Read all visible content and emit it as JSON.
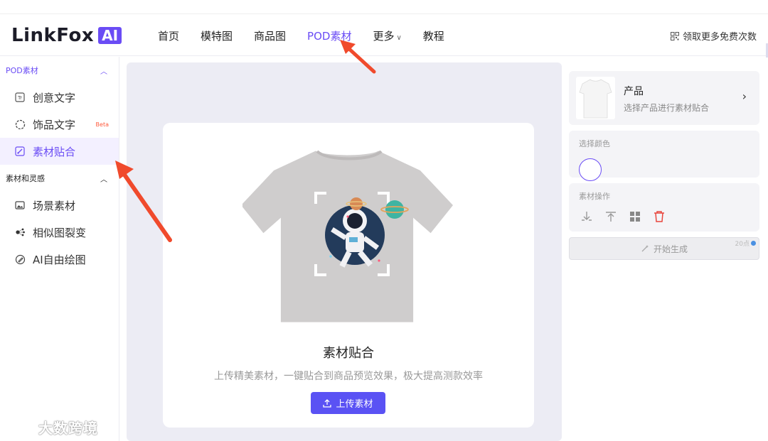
{
  "header": {
    "logo_text": "LinkFox",
    "logo_badge": "AI",
    "nav": [
      {
        "label": "首页"
      },
      {
        "label": "模特图"
      },
      {
        "label": "商品图"
      },
      {
        "label": "POD素材"
      },
      {
        "label": "更多"
      },
      {
        "label": "教程"
      }
    ],
    "free_label": "领取更多免费次数"
  },
  "sidebar": {
    "group1": "POD素材",
    "items1": [
      {
        "label": "创意文字",
        "icon": "text-box-icon"
      },
      {
        "label": "饰品文字",
        "icon": "dashed-circle-icon",
        "badge": "Beta"
      },
      {
        "label": "素材贴合",
        "icon": "brush-icon"
      }
    ],
    "group2": "素材和灵感",
    "items2": [
      {
        "label": "场景素材",
        "icon": "image-icon"
      },
      {
        "label": "相似图裂变",
        "icon": "share-icon"
      },
      {
        "label": "AI自由绘图",
        "icon": "pen-icon"
      }
    ]
  },
  "main": {
    "title": "素材贴合",
    "description": "上传精美素材，一键贴合到商品预览效果，极大提高测款效率",
    "upload_label": "上传素材"
  },
  "right": {
    "product_name": "产品",
    "product_sub": "选择产品进行素材贴合",
    "color_label": "选择颜色",
    "ops_label": "素材操作",
    "generate_label": "开始生成",
    "cost": "20点"
  },
  "watermark": "大数跨境",
  "colors": {
    "accent": "#6a4cf5",
    "button": "#5a52f4",
    "arrow": "#f04a2c"
  }
}
